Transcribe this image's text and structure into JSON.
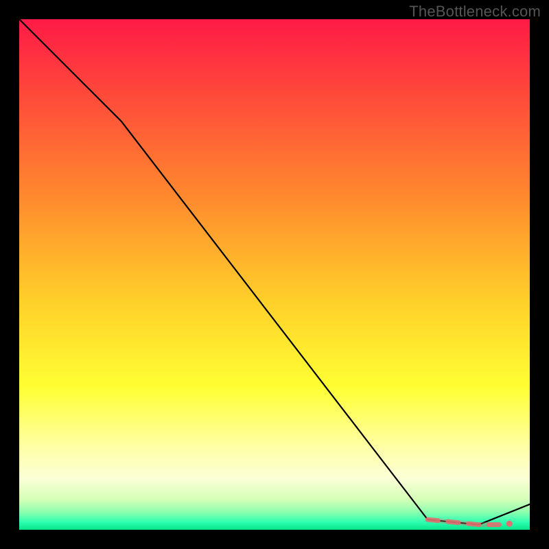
{
  "watermark": "TheBottleneck.com",
  "chart_data": {
    "type": "line",
    "title": "",
    "xlabel": "",
    "ylabel": "",
    "xlim": [
      0,
      100
    ],
    "ylim": [
      0,
      100
    ],
    "grid": false,
    "legend": false,
    "series": [
      {
        "name": "curve",
        "color": "#000000",
        "x": [
          0,
          20,
          80,
          90,
          100
        ],
        "y": [
          100,
          80,
          2,
          1,
          5
        ]
      }
    ],
    "markers": {
      "name": "highlight-segment",
      "color": "#e07070",
      "x": [
        80,
        82,
        84,
        86,
        88,
        90,
        92,
        94
      ],
      "y": [
        2.0,
        1.8,
        1.6,
        1.4,
        1.2,
        1.0,
        1.0,
        1.0
      ]
    },
    "gradient_stops": [
      {
        "offset": 0.0,
        "color": "#ff1a47"
      },
      {
        "offset": 0.15,
        "color": "#ff4a3a"
      },
      {
        "offset": 0.35,
        "color": "#ff8a2e"
      },
      {
        "offset": 0.55,
        "color": "#ffcf2a"
      },
      {
        "offset": 0.72,
        "color": "#ffff33"
      },
      {
        "offset": 0.84,
        "color": "#ffffa8"
      },
      {
        "offset": 0.9,
        "color": "#fbffd6"
      },
      {
        "offset": 0.94,
        "color": "#d6ffb8"
      },
      {
        "offset": 0.965,
        "color": "#8fffb0"
      },
      {
        "offset": 0.985,
        "color": "#2dffb0"
      },
      {
        "offset": 1.0,
        "color": "#05e38a"
      }
    ]
  }
}
